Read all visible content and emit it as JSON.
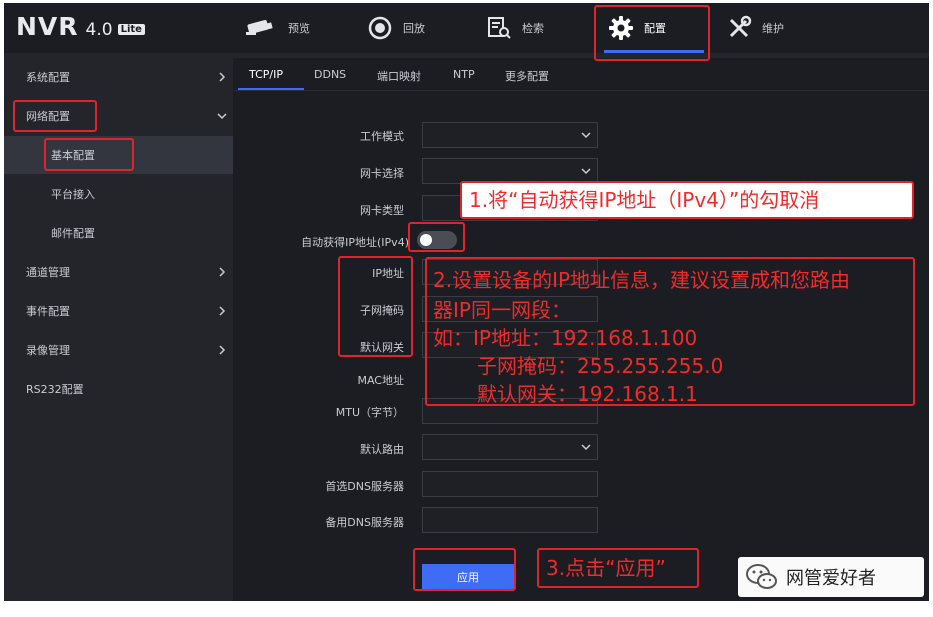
{
  "app": {
    "logo_text": "NVR",
    "version": "4.0",
    "edition_badge": "Lite"
  },
  "top_nav": {
    "items": [
      {
        "label": "预览",
        "icon": "camera-icon"
      },
      {
        "label": "回放",
        "icon": "playback-icon"
      },
      {
        "label": "检索",
        "icon": "search-file-icon"
      },
      {
        "label": "配置",
        "icon": "gear-icon",
        "active": true
      },
      {
        "label": "维护",
        "icon": "wrench-icon"
      }
    ]
  },
  "sidebar": {
    "items": [
      {
        "label": "系统配置",
        "expandable": true
      },
      {
        "label": "网络配置",
        "expanded": true
      },
      {
        "label": "基本配置",
        "sub": true,
        "selected": true
      },
      {
        "label": "平台接入",
        "sub": true
      },
      {
        "label": "邮件配置",
        "sub": true
      },
      {
        "label": "通道管理",
        "expandable": true
      },
      {
        "label": "事件配置",
        "expandable": true
      },
      {
        "label": "录像管理",
        "expandable": true
      },
      {
        "label": "RS232配置"
      }
    ]
  },
  "tabs": [
    {
      "label": "TCP/IP",
      "active": true
    },
    {
      "label": "DDNS"
    },
    {
      "label": "端口映射"
    },
    {
      "label": "NTP"
    },
    {
      "label": "更多配置"
    }
  ],
  "form": {
    "work_mode_label": "工作模式",
    "nic_select_label": "网卡选择",
    "nic_type_label": "网卡类型",
    "dhcp_label": "自动获得IP地址(IPv4)",
    "dhcp_enabled": false,
    "ip_label": "IP地址",
    "mask_label": "子网掩码",
    "gateway_label": "默认网关",
    "mac_label": "MAC地址",
    "mtu_label": "MTU（字节）",
    "default_route_label": "默认路由",
    "dns1_label": "首选DNS服务器",
    "dns2_label": "备用DNS服务器",
    "apply_label": "应用"
  },
  "annotations": {
    "step1": "1.将“自动获得IP地址（IPv4）”的勾取消",
    "step2_lines": [
      "2.设置设备的IP地址信息，建议设置成和您路由",
      "器IP同一网段：",
      "如：IP地址：192.168.1.100",
      "子网掩码：255.255.255.0",
      "默认网关：192.168.1.1"
    ],
    "step3": "3.点击“应用”"
  },
  "watermark": {
    "text": "网管爱好者",
    "icon": "wechat-icon"
  },
  "colors": {
    "accent": "#3f6cf5",
    "annotation_red": "#e1232c",
    "background": "#1b1d22"
  }
}
